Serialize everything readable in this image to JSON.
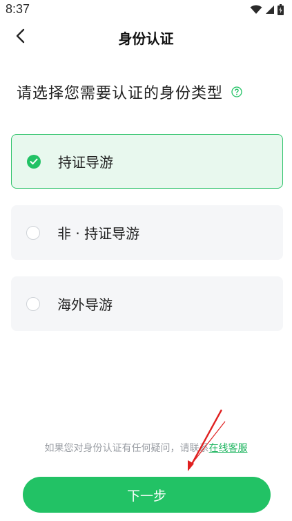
{
  "status_bar": {
    "time": "8:37",
    "icons": [
      "wifi-icon",
      "signal-icon",
      "battery-icon"
    ]
  },
  "header": {
    "back_icon": "chevron-left-icon",
    "title": "身份认证"
  },
  "question": {
    "text": "请选择您需要认证的身份类型",
    "help_icon": "question-circle-icon"
  },
  "options": [
    {
      "label": "持证导游",
      "selected": true
    },
    {
      "label": "非 · 持证导游",
      "selected": false
    },
    {
      "label": "海外导游",
      "selected": false
    }
  ],
  "contact": {
    "text": "如果您对身份认证有任何疑问，请联系",
    "link_label": "在线客服"
  },
  "next_button": {
    "label": "下一步"
  },
  "colors": {
    "accent": "#22c265",
    "selected_bg": "#e8f8ee",
    "option_bg": "#f5f6f8",
    "annotation_arrow": "#e02020"
  }
}
